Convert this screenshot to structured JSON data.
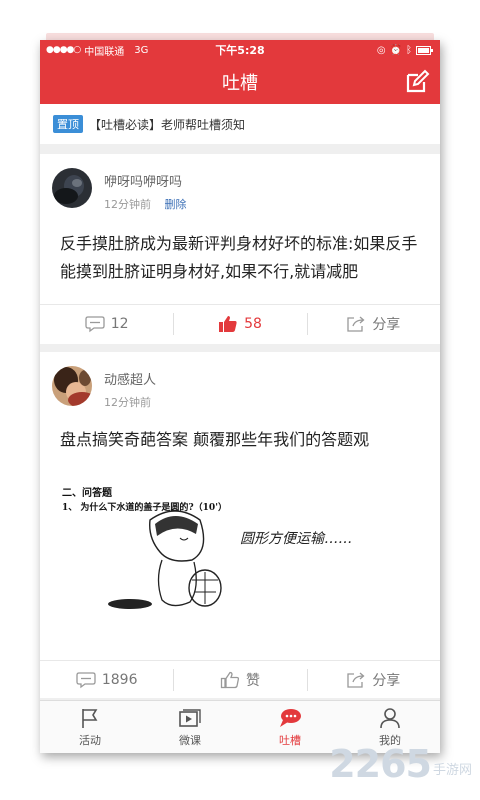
{
  "status_bar": {
    "carrier": "中国联通",
    "network": "3G",
    "time": "下午5:28"
  },
  "header": {
    "title": "吐槽"
  },
  "pinned": {
    "tag": "置顶",
    "text": "【吐槽必读】老师帮吐槽须知"
  },
  "posts": [
    {
      "author": "咿呀吗咿呀吗",
      "time": "12分钟前",
      "delete_label": "删除",
      "content": "反手摸肚脐成为最新评判身材好坏的标准:如果反手能摸到肚脐证明身材好,如果不行,就请减肥",
      "comments": "12",
      "likes": "58",
      "share": "分享"
    },
    {
      "author": "动感超人",
      "time": "12分钟前",
      "content": "盘点搞笑奇葩答案 颠覆那些年我们的答题观",
      "image": {
        "heading": "二、问答题",
        "question": "1、 为什么下水道的盖子是圆的?（10'）",
        "answer": "圆形方便运输……"
      },
      "comments": "1896",
      "likes": "赞",
      "share": "分享"
    }
  ],
  "tabbar": [
    {
      "label": "活动",
      "icon": "flag-icon"
    },
    {
      "label": "微课",
      "icon": "video-icon"
    },
    {
      "label": "吐槽",
      "icon": "chat-bubble-icon"
    },
    {
      "label": "我的",
      "icon": "person-icon"
    }
  ],
  "watermark": {
    "number": "2265",
    "text": "手游网"
  },
  "colors": {
    "brand": "#e3393c",
    "pin_tag": "#3b8ed7",
    "link": "#3b6fb6"
  }
}
